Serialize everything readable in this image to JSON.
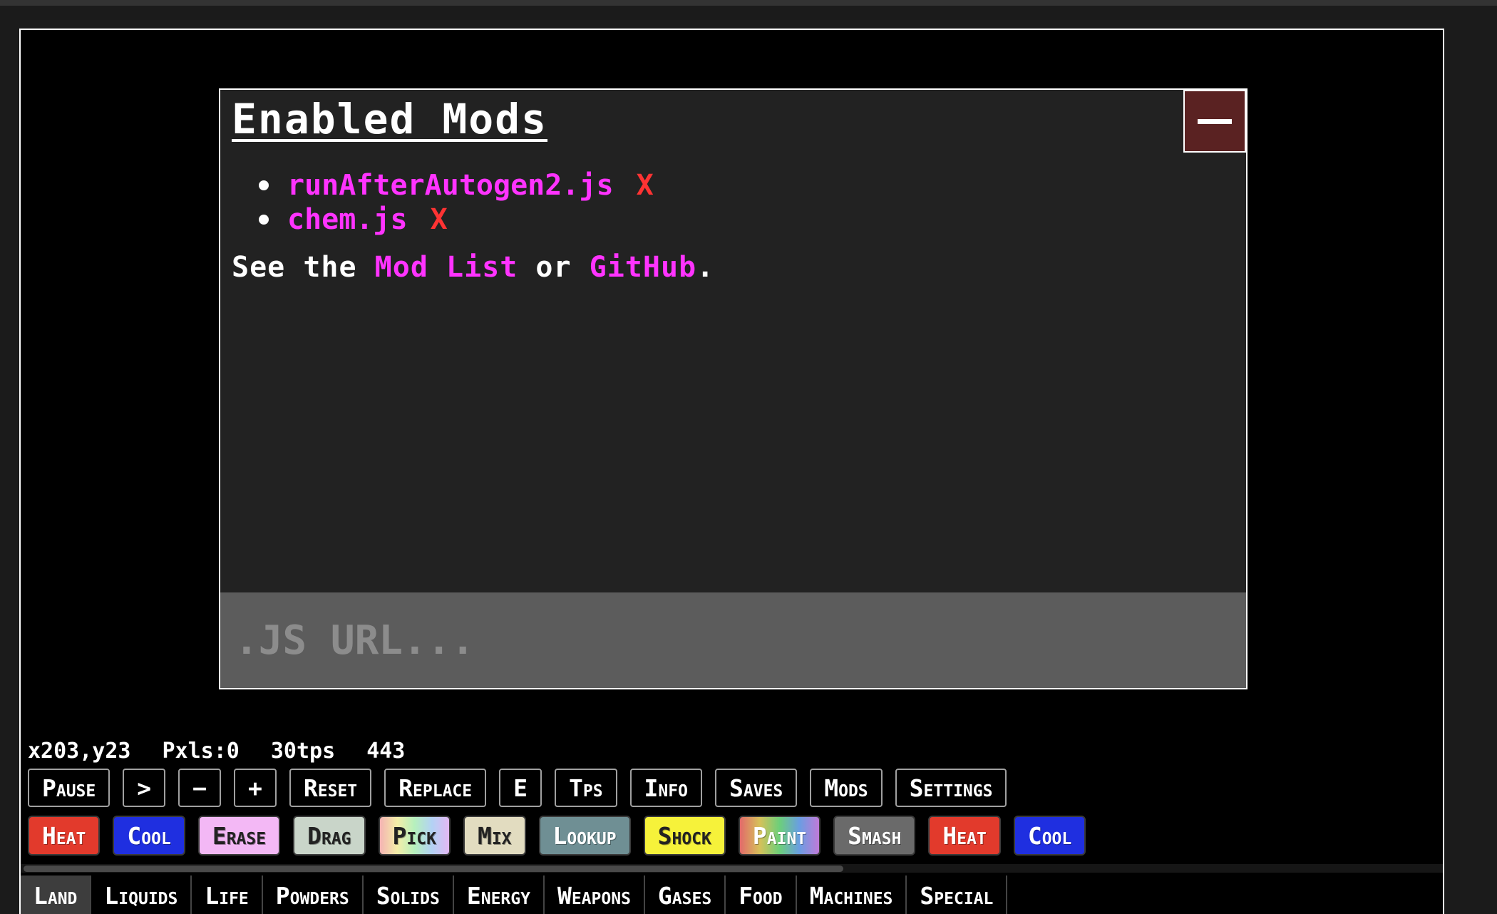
{
  "modal": {
    "title": "Enabled Mods",
    "close_label": "−",
    "mods": [
      {
        "name": "runAfterAutogen2.js",
        "remove": "X"
      },
      {
        "name": "chem.js",
        "remove": "X"
      }
    ],
    "see_prefix": "See the ",
    "mod_list_link": "Mod List",
    "or_text": " or ",
    "github_link": "GitHub",
    "period": ".",
    "url_placeholder": ".JS URL..."
  },
  "stats": {
    "coords": "x203,y23",
    "pixels": "Pxls:0",
    "tps": "30tps",
    "count": "443"
  },
  "controls": [
    "Pause",
    ">",
    "−",
    "+",
    "Reset",
    "Replace",
    "E",
    "Tps",
    "Info",
    "Saves",
    "Mods",
    "Settings"
  ],
  "tools": [
    {
      "label": "Heat",
      "color": "#e23a2c",
      "text": "#ffffff"
    },
    {
      "label": "Cool",
      "color": "#1f2fe0",
      "text": "#ffffff"
    },
    {
      "label": "Erase",
      "color": "#f3b8f5",
      "text": "#222222"
    },
    {
      "label": "Drag",
      "color": "#c9d5c9",
      "text": "#222222"
    },
    {
      "label": "Pick",
      "color": "rainbow-pastel",
      "text": "#222222"
    },
    {
      "label": "Mix",
      "color": "#e2dcc0",
      "text": "#222222"
    },
    {
      "label": "Lookup",
      "color": "#6f8f94",
      "text": "#ffffff"
    },
    {
      "label": "Shock",
      "color": "#f6f23a",
      "text": "#222222"
    },
    {
      "label": "Paint",
      "color": "rainbow",
      "text": "#ffffff"
    },
    {
      "label": "Smash",
      "color": "#6a6a6a",
      "text": "#ffffff"
    },
    {
      "label": "Heat",
      "color": "#e23a2c",
      "text": "#ffffff"
    },
    {
      "label": "Cool",
      "color": "#1f2fe0",
      "text": "#ffffff"
    }
  ],
  "categories": [
    "Land",
    "Liquids",
    "Life",
    "Powders",
    "Solids",
    "Energy",
    "Weapons",
    "Gases",
    "Food",
    "Machines",
    "Special"
  ],
  "active_category": "Land"
}
